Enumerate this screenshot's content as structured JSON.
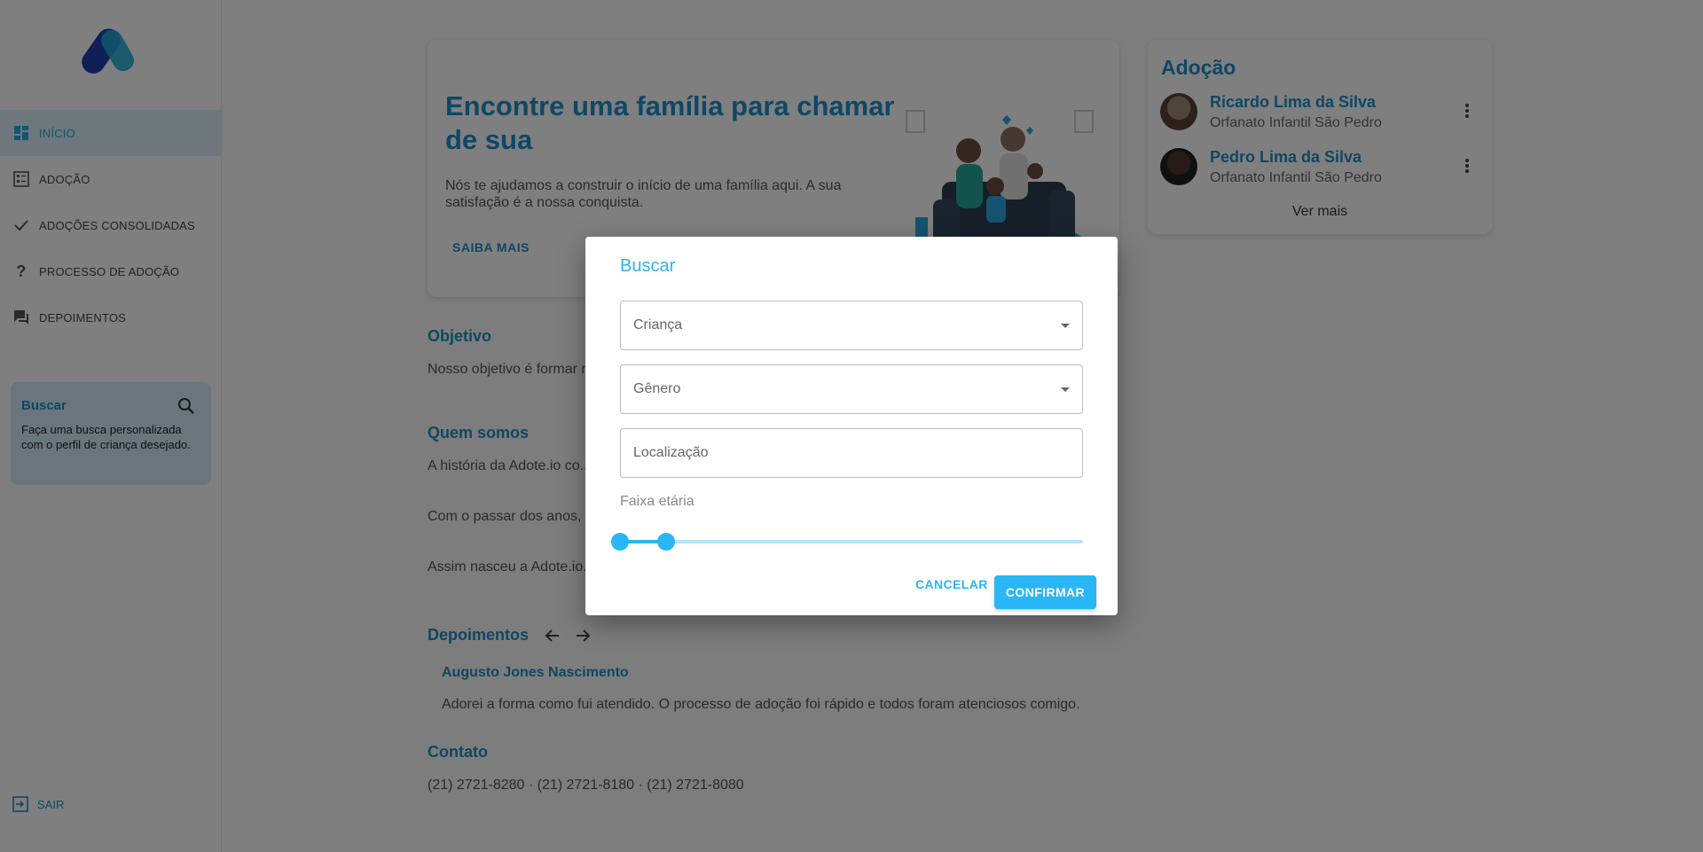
{
  "sidebar": {
    "items": [
      {
        "label": "INÍCIO",
        "icon": "dashboard-icon",
        "active": true
      },
      {
        "label": "ADOÇÃO",
        "icon": "list-icon"
      },
      {
        "label": "ADOÇÕES CONSOLIDADAS",
        "icon": "check-icon"
      },
      {
        "label": "PROCESSO DE ADOÇÃO",
        "icon": "question-icon"
      },
      {
        "label": "DEPOIMENTOS",
        "icon": "chat-icon"
      }
    ],
    "search_card": {
      "title": "Buscar",
      "text": "Faça uma busca personalizada com o perfil de criança desejado."
    },
    "logout_label": "SAIR"
  },
  "hero": {
    "title": "Encontre uma família para chamar de sua",
    "text": "Nós te ajudamos a construir o início de uma família aqui. A sua satisfação é a nossa conquista.",
    "link": "SAIBA MAIS"
  },
  "sections": {
    "objetivo_title": "Objetivo",
    "objetivo_text": "Nosso objetivo é formar n... estão em nossos abrigos",
    "quem_title": "Quem somos",
    "quem_p1": "A história da Adote.io co... Rio de Janeiro que come...",
    "quem_p2": "Com o passar dos anos, ... cuidados de Dona Chica ...",
    "quem_p3": "Assim nasceu a Adote.io... elas. E nós fazemos a po...",
    "depoimentos_title": "Depoimentos",
    "dep_name": "Augusto Jones Nascimento",
    "dep_text": "Adorei a forma como fui atendido. O processo de adoção foi rápido e todos foram atenciosos comigo.",
    "contato_title": "Contato",
    "contato_text": "(21) 2721-8280 · (21) 2721-8180 · (21) 2721-8080"
  },
  "adoption": {
    "title": "Adoção",
    "items": [
      {
        "name": "Ricardo Lima da Silva",
        "org": "Orfanato Infantil São Pedro"
      },
      {
        "name": "Pedro Lima da Silva",
        "org": "Orfanato Infantil São Pedro"
      }
    ],
    "see_more": "Ver mais"
  },
  "dialog": {
    "title": "Buscar",
    "child_placeholder": "Criança",
    "gender_placeholder": "Gênero",
    "location_placeholder": "Localização",
    "range_label": "Faixa etária",
    "range_min": 0,
    "range_max": 0.1,
    "cancel": "CANCELAR",
    "confirm": "CONFIRMAR"
  },
  "colors": {
    "primary": "#1f8fc8",
    "accent": "#29b6f6"
  }
}
